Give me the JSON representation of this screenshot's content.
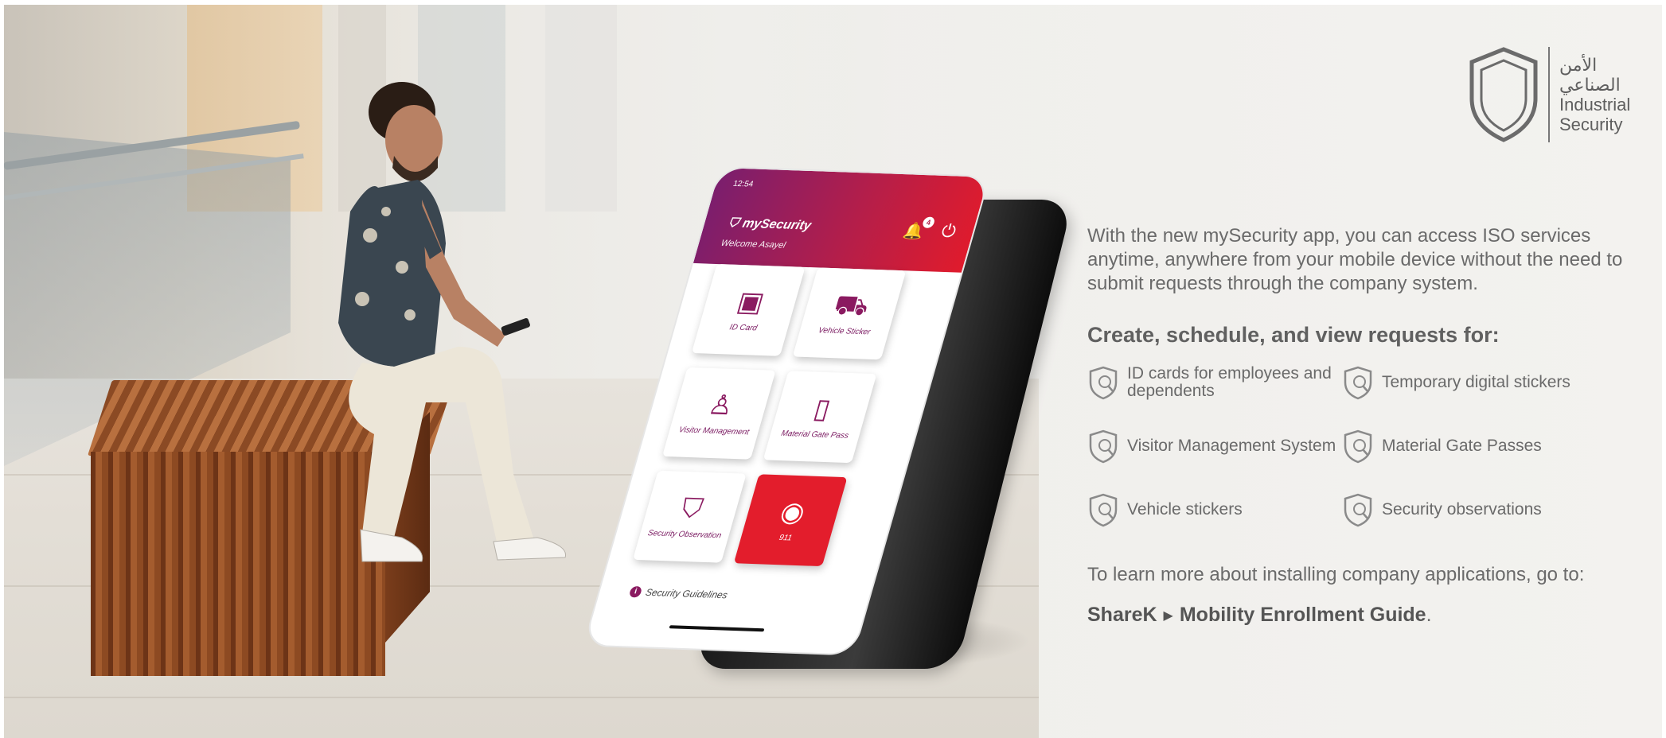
{
  "logo": {
    "arabic_line1": "الأمن",
    "arabic_line2": "الصناعي",
    "english_line1": "Industrial",
    "english_line2": "Security"
  },
  "phone": {
    "status_time": "12:54",
    "app_name": "mySecurity",
    "welcome": "Welcome Asayel",
    "notification_count": "4",
    "tiles": [
      {
        "label": "ID Card",
        "icon": "id-card-icon"
      },
      {
        "label": "Vehicle Sticker",
        "icon": "car-icon"
      },
      {
        "label": "Visitor Management",
        "icon": "person-icon"
      },
      {
        "label": "Material Gate Pass",
        "icon": "gate-pass-icon"
      },
      {
        "label": "Security Observation",
        "icon": "shield-icon"
      },
      {
        "label": "911",
        "icon": "emergency-icon"
      }
    ],
    "guidelines": "Security Guidelines"
  },
  "copy": {
    "intro": "With the new mySecurity app, you can access ISO services anytime, anywhere from your mobile device without the need to submit requests through the company system.",
    "heading": "Create, schedule, and view requests for:",
    "features": [
      "ID cards for employees and dependents",
      "Temporary digital stickers",
      "Visitor Management System",
      "Material Gate Passes",
      "Vehicle stickers",
      "Security observations"
    ],
    "learn_more": "To learn more about installing company applications, go to:",
    "link_part1": "ShareK",
    "link_part2": "Mobility Enrollment Guide",
    "link_end": "."
  },
  "colors": {
    "accent_magenta": "#8a1a60",
    "accent_red": "#e31d2c",
    "text_gray": "#6a6a6a"
  }
}
